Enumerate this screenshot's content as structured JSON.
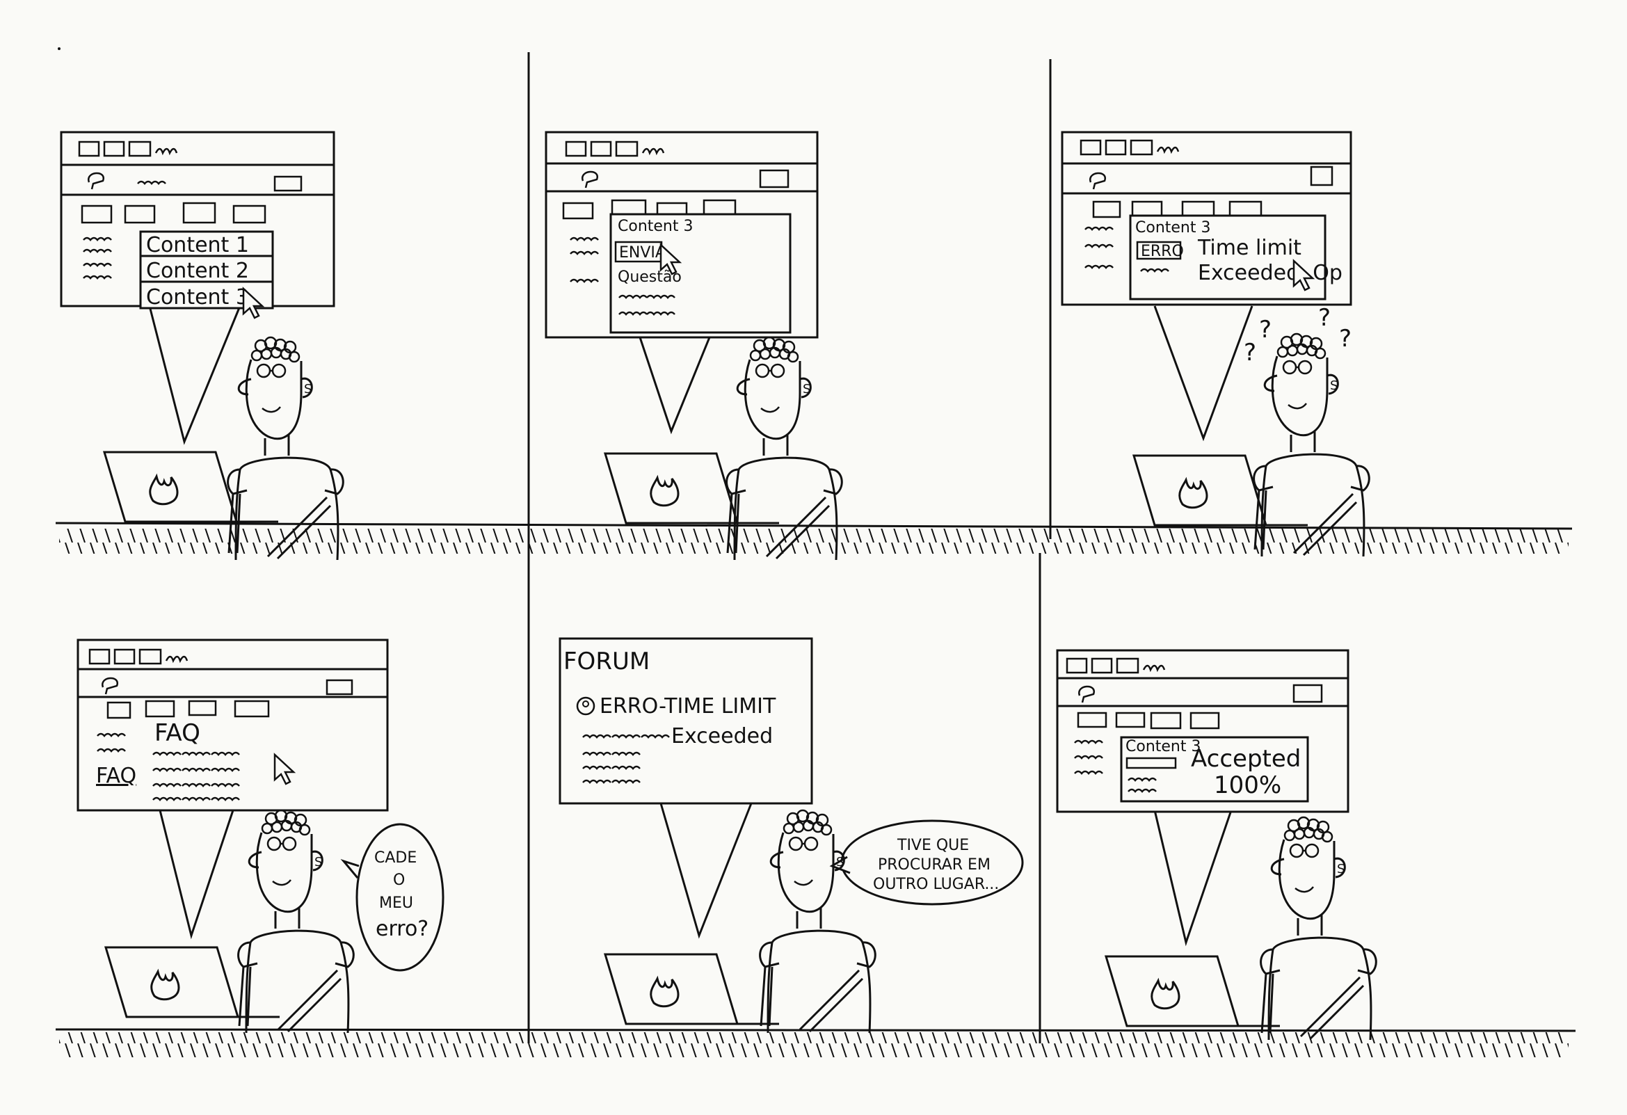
{
  "panels": [
    {
      "id": "panel-1",
      "menu_items": [
        "Content 1",
        "Content 2",
        "Content 3"
      ]
    },
    {
      "id": "panel-2",
      "content_title": "Content 3",
      "submit_button": "ENVIA",
      "question_label": "Questão"
    },
    {
      "id": "panel-3",
      "content_title": "Content 3",
      "error_badge": "ERRO",
      "result_line_1": "Time limit",
      "result_line_2": "Exceeded, Op",
      "thought_marks": [
        "?",
        "?",
        "?",
        "?"
      ]
    },
    {
      "id": "panel-4",
      "faq_title": "FAQ",
      "sidebar_link": "FAQ",
      "speech_line_1": "CADE",
      "speech_line_2": "O",
      "speech_line_3": "MEU",
      "speech_line_4": "erro?"
    },
    {
      "id": "panel-5",
      "forum_title": "FORUM",
      "post_line_1": "ERRO-TIME LIMIT",
      "post_line_2": "Exceeded",
      "speech_line_1": "TIVE QUE",
      "speech_line_2": "PROCURAR EM",
      "speech_line_3": "OUTRO LUGAR..."
    },
    {
      "id": "panel-6",
      "content_title": "Content 3",
      "result_line_1": "Accepted",
      "result_line_2": "100%"
    }
  ],
  "colors": {
    "ink": "#111111",
    "paper": "#fafaf7"
  }
}
